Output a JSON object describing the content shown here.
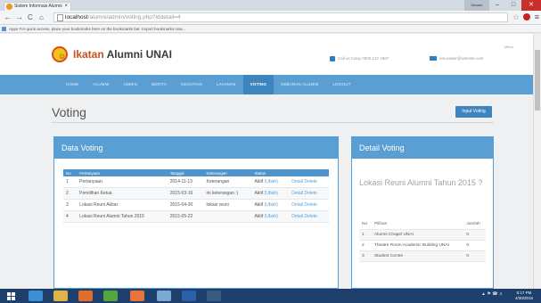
{
  "browser": {
    "tab_title": "Sistem Informasi Alumni",
    "tab_close": "×",
    "user_label": "Ubuntu",
    "url_host": "localhost",
    "url_path": "/alumni/admin/voting.php?iddetail=4",
    "bookmark_bar_text": "Apps  For quick access, place your bookmarks here on the bookmarks bar. Import bookmarks now..."
  },
  "site": {
    "brand_prefix": "Ikatan",
    "brand_rest": " Alumni UNAI",
    "phone": "Call us today 0800 122 4567",
    "email": "emucaker@website.com",
    "menu_hint": "Menu",
    "nav": [
      "HOME",
      "ALUMNI",
      "ADMIN",
      "BERITA",
      "KEGIATAN",
      "LAYANAN",
      "VOTING",
      "SEBARAN ALUMNI",
      "LOGOUT"
    ],
    "active_nav": "VOTING"
  },
  "page": {
    "heading": "Voting",
    "input_button": "Input Voting"
  },
  "data_voting": {
    "title": "Data Voting",
    "columns": [
      "No",
      "Pertanyaan",
      "Tanggal",
      "Keterangan",
      "Status",
      ""
    ],
    "rows": [
      {
        "no": "1",
        "pertanyaan": "Pertanyaan",
        "tanggal": "2014-11-13",
        "keterangan": "Keterangan",
        "status": "Aktif",
        "ubah": "(Ubah)",
        "detail": "Detail",
        "delete": "Delete"
      },
      {
        "no": "2",
        "pertanyaan": "Pemilihan Ketua",
        "tanggal": "2015-03-16",
        "keterangan": "ini keterangan :)",
        "status": "Aktif",
        "ubah": "(Ubah)",
        "detail": "Detail",
        "delete": "Delete"
      },
      {
        "no": "3",
        "pertanyaan": "Lokasi Reuni Akbar",
        "tanggal": "2015-04-30",
        "keterangan": "lokasi reuni",
        "status": "Aktif",
        "ubah": "(Ubah)",
        "detail": "Detail",
        "delete": "Delete"
      },
      {
        "no": "4",
        "pertanyaan": "Lokasi Reuni Alumni Tahun 2015",
        "tanggal": "2015-05-22",
        "keterangan": "",
        "status": "Aktif",
        "ubah": "(Ubah)",
        "detail": "Detail",
        "delete": "Delete"
      }
    ]
  },
  "detail_voting": {
    "title": "Detail Voting",
    "question": "Lokasi Reuni Alumni Tahun 2015 ?",
    "columns": [
      "No",
      "Pilihan",
      "Jumlah"
    ],
    "rows": [
      {
        "no": "1",
        "pilihan": "Alumni Chapel UNAI",
        "jumlah": "0"
      },
      {
        "no": "2",
        "pilihan": "Theatre Room Academic Building UNAI",
        "jumlah": "0"
      },
      {
        "no": "3",
        "pilihan": "Student Centre",
        "jumlah": "0"
      }
    ]
  },
  "taskbar": {
    "time": "5:17 PM",
    "date": "4/30/2015"
  }
}
